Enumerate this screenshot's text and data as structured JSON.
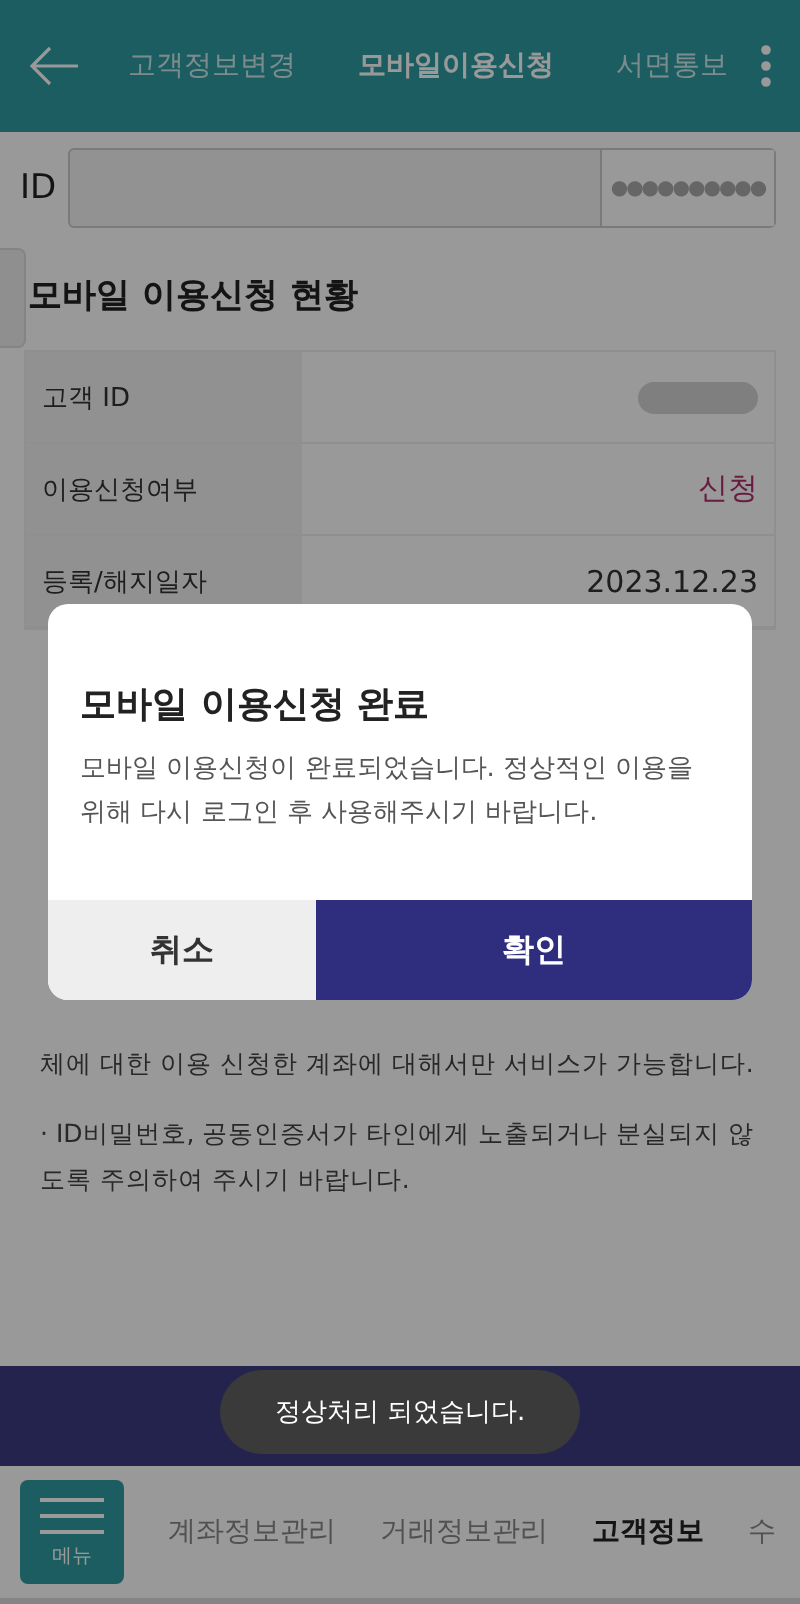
{
  "header": {
    "tabs": [
      {
        "label": "고객정보변경",
        "selected": false
      },
      {
        "label": "모바일이용신청",
        "selected": true
      },
      {
        "label": "서면통보",
        "selected": false
      }
    ]
  },
  "login": {
    "label": "ID",
    "password_mask": "●●●●●●●●●●"
  },
  "status_section": {
    "title": "모바일 이용신청 현황",
    "rows": [
      {
        "label": "고객 ID",
        "kind": "blurred"
      },
      {
        "label": "이용신청여부",
        "value": "신청",
        "kind": "highlight"
      },
      {
        "label": "등록/해지일자",
        "value": "2023.12.23",
        "kind": "plain"
      }
    ]
  },
  "notice_lines": [
    "체에 대한 이용 신청한 계좌에 대해서만 서비스가 가능합니다.",
    "· ID비밀번호, 공동인증서가 타인에게 노출되거나 분실되지 않도록 주의하여 주시기 바랍니다."
  ],
  "dialog": {
    "title": "모바일 이용신청 완료",
    "message": "모바일 이용신청이 완료되었습니다. 정상적인 이용을 위해 다시 로그인 후 사용해주시기 바랍니다.",
    "buttons": [
      {
        "label": "취소",
        "kind": "secondary"
      },
      {
        "label": "확인",
        "kind": "primary"
      }
    ]
  },
  "toast": "정상처리 되었습니다.",
  "bottom_nav": {
    "menu_label": "메뉴",
    "tabs": [
      {
        "label": "계좌정보관리",
        "selected": false
      },
      {
        "label": "거래정보관리",
        "selected": false
      },
      {
        "label": "고객정보",
        "selected": true
      },
      {
        "label": "수",
        "selected": false
      }
    ]
  }
}
